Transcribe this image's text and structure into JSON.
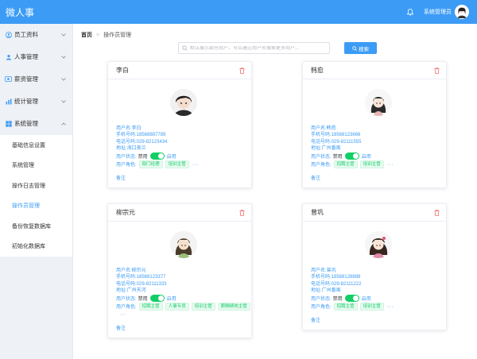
{
  "app": {
    "title": "微人事"
  },
  "header": {
    "username": "系统管理员"
  },
  "sidebar": {
    "items": [
      {
        "label": "员工资料",
        "icon": "person-icon"
      },
      {
        "label": "人事管理",
        "icon": "user-icon"
      },
      {
        "label": "薪资管理",
        "icon": "money-icon"
      },
      {
        "label": "统计管理",
        "icon": "chart-icon"
      },
      {
        "label": "系统管理",
        "icon": "windows-icon"
      }
    ],
    "submenu": [
      {
        "label": "基础信息设置"
      },
      {
        "label": "系统管理"
      },
      {
        "label": "操作日志管理"
      },
      {
        "label": "操作员管理",
        "active": true
      },
      {
        "label": "备份恢复数据库"
      },
      {
        "label": "初始化数据库"
      }
    ]
  },
  "breadcrumb": {
    "home": "首页",
    "current": "操作员管理"
  },
  "search": {
    "placeholder": "默认展示部分用户，可以通过用户名搜索更多用户...",
    "button_label": "搜索"
  },
  "labels": {
    "username": "用户名:",
    "phone": "手机号码:",
    "tel": "电话号码:",
    "address": "地址:",
    "status": "用户状态:",
    "disabled": "禁用",
    "enabled": "启用",
    "roles": "用户角色:",
    "more": "···",
    "remark": "备注"
  },
  "cards": [
    {
      "name": "李白",
      "username": "李白",
      "phone": "18568887789",
      "tel": "029-82123434",
      "address": "海口美兰",
      "roles": [
        "部门经理",
        "培训主管"
      ]
    },
    {
      "name": "韩愈",
      "username": "韩愈",
      "phone": "18568123666",
      "tel": "029-82111555",
      "address": "广州番禺",
      "roles": [
        "招聘主管",
        "培训主管"
      ]
    },
    {
      "name": "柳宗元",
      "username": "柳宗元",
      "phone": "18568123377",
      "tel": "029-82111333",
      "address": "广州天河",
      "roles": [
        "招聘主管",
        "人事专员",
        "培训主管",
        "薪酬绩效主管"
      ]
    },
    {
      "name": "曾巩",
      "username": "曾巩",
      "phone": "18568128888",
      "tel": "029-82111222",
      "address": "广州番禺",
      "roles": [
        "招聘主管",
        "培训主管"
      ]
    }
  ],
  "colors": {
    "primary": "#3c9cf5",
    "success": "#13ce66",
    "danger": "#f56c6c"
  }
}
